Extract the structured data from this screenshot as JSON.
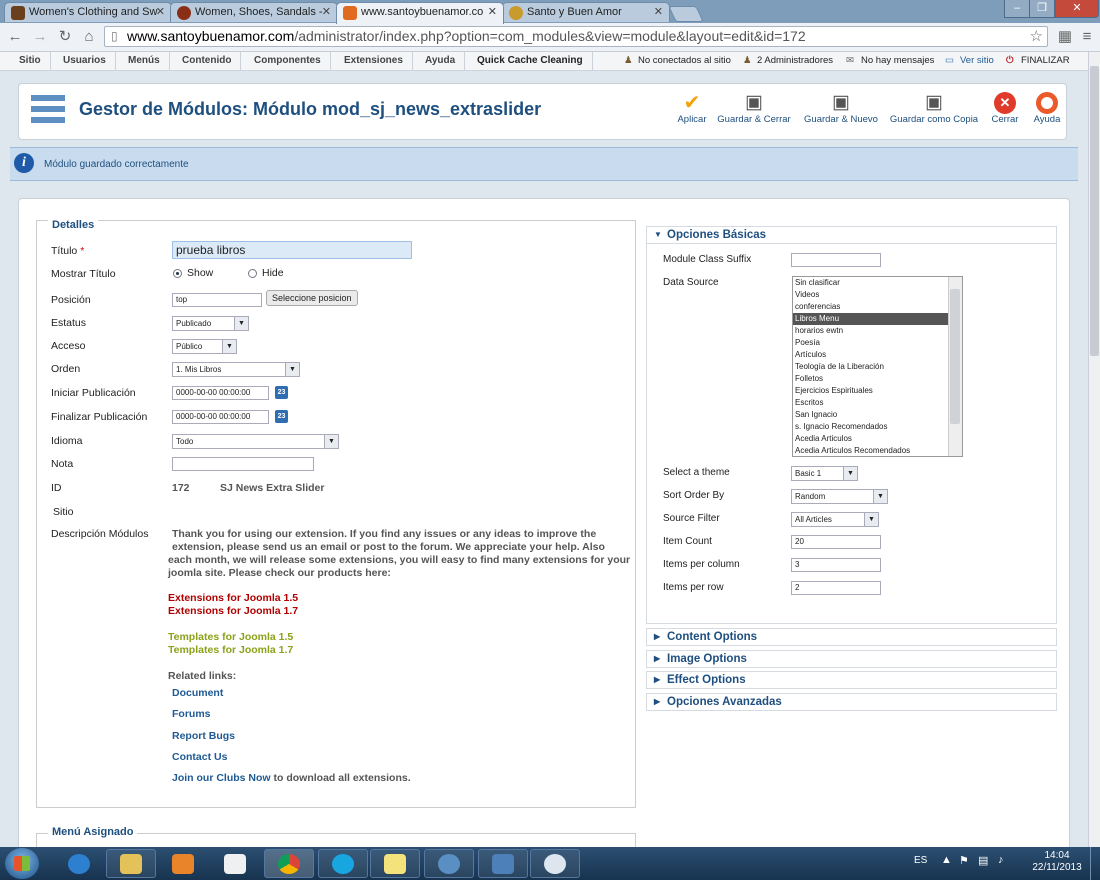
{
  "browser": {
    "tabs": [
      {
        "label": "Women's Clothing and Sw",
        "favicon_color": "#6a3f1c"
      },
      {
        "label": "Women, Shoes, Sandals -",
        "favicon_color": "#8a2f17"
      },
      {
        "label": "www.santoybuenamor.co",
        "favicon_color": "#e06a1f"
      },
      {
        "label": "Santo y Buen Amor",
        "favicon_color": "#c89b2c"
      }
    ],
    "url_host": "www.santoybuenamor.com",
    "url_path": "/administrator/index.php?option=com_modules&view=module&layout=edit&id=172"
  },
  "adminmenu": {
    "items": [
      "Sitio",
      "Usuarios",
      "Menús",
      "Contenido",
      "Componentes",
      "Extensiones",
      "Ayuda",
      "Quick Cache Cleaning"
    ],
    "status": {
      "not_connected": "No conectados al sitio",
      "admins": "2 Administradores",
      "messages": "No hay mensajes",
      "view_site": "Ver sitio",
      "logout": "FINALIZAR"
    }
  },
  "header": {
    "title": "Gestor de Módulos: Módulo mod_sj_news_extraslider",
    "actions": {
      "apply": "Aplicar",
      "save_close": "Guardar & Cerrar",
      "save_new": "Guardar & Nuevo",
      "save_copy": "Guardar como Copia",
      "close": "Cerrar",
      "help": "Ayuda"
    }
  },
  "message": "Módulo guardado correctamente",
  "details": {
    "legend": "Detalles",
    "labels": {
      "title": "Título",
      "required_mark": "*",
      "show_title": "Mostrar Título",
      "position": "Posición",
      "status": "Estatus",
      "access": "Acceso",
      "order": "Orden",
      "publish_up": "Iniciar Publicación",
      "publish_down": "Finalizar Publicación",
      "language": "Idioma",
      "note": "Nota",
      "id": "ID",
      "site": "Sitio",
      "description": "Descripción Módulos"
    },
    "values": {
      "title": "prueba libros",
      "show": "Show",
      "hide": "Hide",
      "position": "top",
      "select_position": "Seleccione posicion",
      "status": "Publicado",
      "access": "Público",
      "order": "1. Mis Libros",
      "publish_up": "0000-00-00 00:00:00",
      "publish_down": "0000-00-00 00:00:00",
      "language": "Todo",
      "note": "",
      "id": "172",
      "module_name": "SJ News Extra Slider",
      "calendar_day": "23"
    },
    "desc": {
      "line1": "Thank you for using our extension. If you find any issues or any ideas to improve the",
      "line2": "extension, please send us an email or post to the forum. We appreciate your help. Also",
      "line3": "each month, we will release some extensions, you will easy to find many extensions for your",
      "line4": "joomla site. Please check our products here:",
      "ext15": "Extensions for Joomla 1.5",
      "ext17": "Extensions for Joomla 1.7",
      "tpl15": "Templates for Joomla 1.5",
      "tpl17": "Templates for Joomla 1.7",
      "related": "Related links:",
      "document": "Document",
      "forums": "Forums",
      "bugs": "Report Bugs",
      "contact": "Contact Us",
      "join": "Join our Clubs Now",
      "join_rest": "to download all extensions."
    }
  },
  "assigned_menu": "Menú Asignado",
  "options": {
    "basic_title": "Opciones Básicas",
    "labels": {
      "class_suffix": "Module Class Suffix",
      "data_source": "Data Source",
      "theme": "Select a theme",
      "sort": "Sort Order By",
      "filter": "Source Filter",
      "count": "Item Count",
      "per_column": "Items per column",
      "per_row": "Items per row"
    },
    "values": {
      "class_suffix": "",
      "theme": "Basic 1",
      "sort": "Random",
      "filter": "All Articles",
      "count": "20",
      "per_column": "3",
      "per_row": "2"
    },
    "sources": [
      "Sin clasificar",
      "Videos",
      "conferencias",
      "Libros Menu",
      "horarios ewtn",
      "Poesía",
      "Artículos",
      "Teología de la Liberación",
      "Folletos",
      "Ejercicios Espirituales",
      "Escritos",
      "San Ignacio",
      "s. Ignacio Recomendados",
      "Acedia Articulos",
      "Acedia Articulos Recomendados"
    ],
    "selected_source": "Libros Menu",
    "sections": [
      "Content Options",
      "Image Options",
      "Effect Options",
      "Opciones Avanzadas"
    ]
  },
  "taskbar": {
    "lang": "ES",
    "time": "14:04",
    "date": "22/11/2013"
  }
}
